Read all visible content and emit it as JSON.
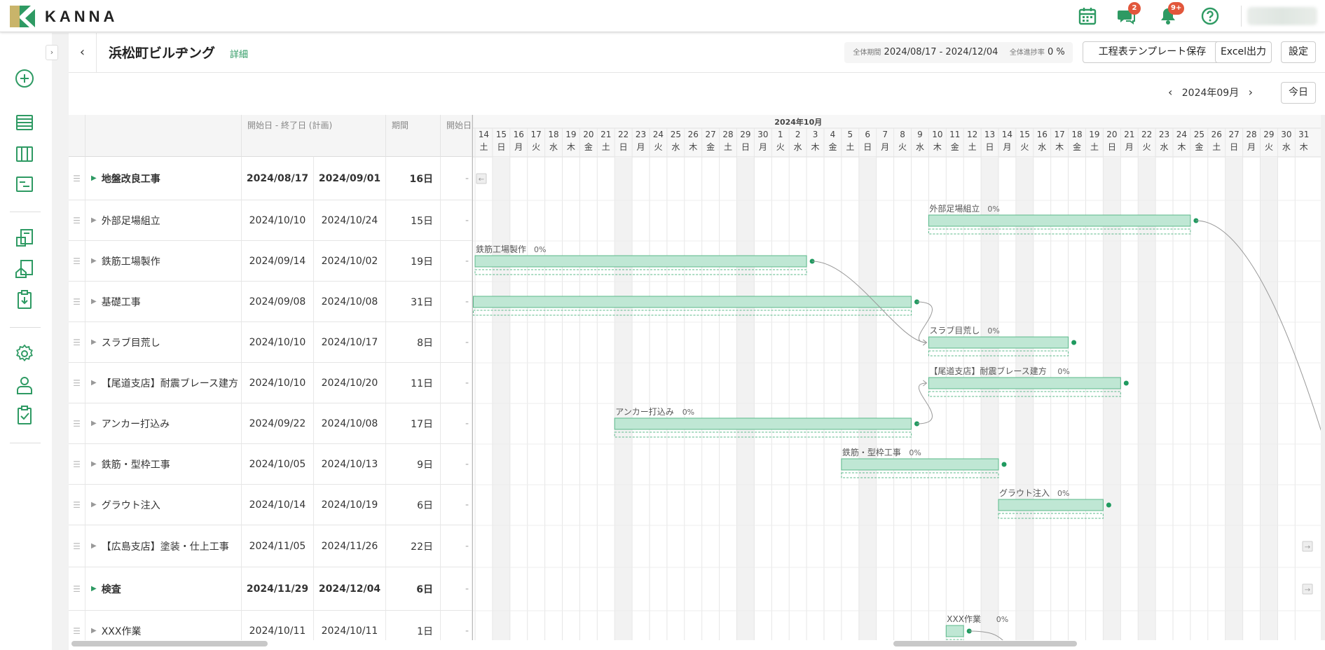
{
  "app": {
    "brand": "KANNA",
    "chat_badge": "2",
    "notif_badge": "9+"
  },
  "header": {
    "title": "浜松町ビルヂング",
    "detail_link": "詳細",
    "period_label": "全体期間",
    "period_value": "2024/08/17 - 2024/12/04",
    "progress_label": "全体進捗率",
    "progress_value": "0 %",
    "btn_template": "工程表テンプレート保存",
    "btn_excel": "Excel出力",
    "btn_settings": "設定"
  },
  "calendar": {
    "month_label": "2024年09月",
    "today": "今日",
    "month_header": "2024年10月"
  },
  "table": {
    "col_dates": "開始日 - 終了日 (計画)",
    "col_period": "期間",
    "col_extra": "開始日",
    "rows": [
      {
        "name": "地盤改良工事",
        "start": "2024/08/17",
        "end": "2024/09/01",
        "dur": "16日",
        "ext": "-",
        "bold": true,
        "parent": true,
        "h": 62
      },
      {
        "name": "外部足場組立",
        "start": "2024/10/10",
        "end": "2024/10/24",
        "dur": "15日",
        "ext": "-",
        "h": 58
      },
      {
        "name": "鉄筋工場製作",
        "start": "2024/09/14",
        "end": "2024/10/02",
        "dur": "19日",
        "ext": "-",
        "h": 58
      },
      {
        "name": "基礎工事",
        "start": "2024/09/08",
        "end": "2024/10/08",
        "dur": "31日",
        "ext": "-",
        "h": 58
      },
      {
        "name": "スラブ目荒し",
        "start": "2024/10/10",
        "end": "2024/10/17",
        "dur": "8日",
        "ext": "-",
        "h": 58
      },
      {
        "name": "【尾道支店】耐震ブレース建方",
        "start": "2024/10/10",
        "end": "2024/10/20",
        "dur": "11日",
        "ext": "-",
        "h": 58
      },
      {
        "name": "アンカー打込み",
        "start": "2024/09/22",
        "end": "2024/10/08",
        "dur": "17日",
        "ext": "-",
        "h": 58
      },
      {
        "name": "鉄筋・型枠工事",
        "start": "2024/10/05",
        "end": "2024/10/13",
        "dur": "9日",
        "ext": "-",
        "h": 58
      },
      {
        "name": "グラウト注入",
        "start": "2024/10/14",
        "end": "2024/10/19",
        "dur": "6日",
        "ext": "-",
        "h": 58
      },
      {
        "name": "【広島支店】塗装・仕上工事",
        "start": "2024/11/05",
        "end": "2024/11/26",
        "dur": "22日",
        "ext": "-",
        "h": 60
      },
      {
        "name": "検査",
        "start": "2024/11/29",
        "end": "2024/12/04",
        "dur": "6日",
        "ext": "-",
        "bold": true,
        "parent": true,
        "h": 62
      },
      {
        "name": "XXX作業",
        "start": "2024/10/11",
        "end": "2024/10/11",
        "dur": "1日",
        "ext": "-",
        "h": 58
      }
    ]
  },
  "gantt": {
    "days": [
      [
        "14",
        "土"
      ],
      [
        "15",
        "日"
      ],
      [
        "16",
        "月"
      ],
      [
        "17",
        "火"
      ],
      [
        "18",
        "水"
      ],
      [
        "19",
        "木"
      ],
      [
        "20",
        "金"
      ],
      [
        "21",
        "土"
      ],
      [
        "22",
        "日"
      ],
      [
        "23",
        "月"
      ],
      [
        "24",
        "火"
      ],
      [
        "25",
        "水"
      ],
      [
        "26",
        "木"
      ],
      [
        "27",
        "金"
      ],
      [
        "28",
        "土"
      ],
      [
        "29",
        "日"
      ],
      [
        "30",
        "月"
      ],
      [
        "1",
        "火"
      ],
      [
        "2",
        "水"
      ],
      [
        "3",
        "木"
      ],
      [
        "4",
        "金"
      ],
      [
        "5",
        "土"
      ],
      [
        "6",
        "日"
      ],
      [
        "7",
        "月"
      ],
      [
        "8",
        "火"
      ],
      [
        "9",
        "水"
      ],
      [
        "10",
        "木"
      ],
      [
        "11",
        "金"
      ],
      [
        "12",
        "土"
      ],
      [
        "13",
        "日"
      ],
      [
        "14",
        "月"
      ],
      [
        "15",
        "火"
      ],
      [
        "16",
        "水"
      ],
      [
        "17",
        "木"
      ],
      [
        "18",
        "金"
      ],
      [
        "19",
        "土"
      ],
      [
        "20",
        "日"
      ],
      [
        "21",
        "月"
      ],
      [
        "22",
        "火"
      ],
      [
        "23",
        "水"
      ],
      [
        "24",
        "木"
      ],
      [
        "25",
        "金"
      ],
      [
        "26",
        "土"
      ],
      [
        "27",
        "日"
      ],
      [
        "28",
        "月"
      ],
      [
        "29",
        "火"
      ],
      [
        "30",
        "水"
      ],
      [
        "31",
        "木"
      ]
    ],
    "shaded_days": [
      "15",
      "22",
      "29",
      "6",
      "13",
      "20",
      "27"
    ],
    "bars": [
      {
        "row": 1,
        "label": "外部足場組立",
        "pct": "0%",
        "start": 26,
        "len": 15
      },
      {
        "row": 2,
        "label": "鉄筋工場製作",
        "pct": "0%",
        "start": 0,
        "len": 19
      },
      {
        "row": 3,
        "label": "",
        "pct": "",
        "start": -0.1,
        "len": 25.1
      },
      {
        "row": 4,
        "label": "スラブ目荒し",
        "pct": "0%",
        "start": 26,
        "len": 8
      },
      {
        "row": 5,
        "label": "【尾道支店】耐震ブレース建方",
        "pct": "0%",
        "start": 26,
        "len": 11
      },
      {
        "row": 6,
        "label": "アンカー打込み",
        "pct": "0%",
        "start": 8,
        "len": 17
      },
      {
        "row": 7,
        "label": "鉄筋・型枠工事",
        "pct": "0%",
        "start": 21,
        "len": 9
      },
      {
        "row": 8,
        "label": "グラウト注入",
        "pct": "0%",
        "start": 30,
        "len": 6
      },
      {
        "row": 11,
        "label": "XXX作業",
        "pct": "0%",
        "start": 27,
        "len": 1
      }
    ]
  }
}
